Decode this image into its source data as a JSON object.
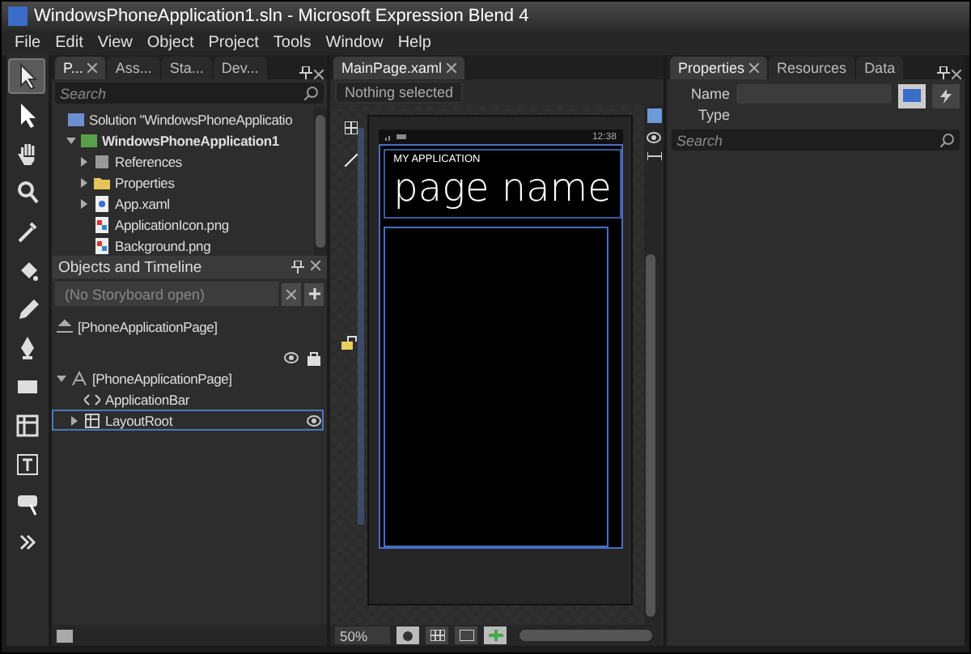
{
  "window": {
    "title": "WindowsPhoneApplication1.sln - Microsoft Expression Blend 4"
  },
  "menu": [
    "File",
    "Edit",
    "View",
    "Object",
    "Project",
    "Tools",
    "Window",
    "Help"
  ],
  "tools": [
    {
      "kind": "select",
      "selected": true
    },
    {
      "kind": "direct",
      "selected": false
    },
    {
      "kind": "hand",
      "selected": false
    },
    {
      "kind": "zoom",
      "selected": false
    },
    {
      "kind": "dropper",
      "selected": false
    },
    {
      "kind": "bucket",
      "selected": false
    },
    {
      "kind": "brush",
      "selected": false
    },
    {
      "kind": "pen",
      "selected": false
    },
    {
      "kind": "rect",
      "selected": false
    },
    {
      "kind": "grid",
      "selected": false
    },
    {
      "kind": "text",
      "selected": false
    },
    {
      "kind": "callout",
      "selected": false
    },
    {
      "kind": "more",
      "selected": false
    }
  ],
  "project_panel": {
    "tabs": [
      {
        "label": "P...",
        "selected": true
      },
      {
        "label": "Ass...",
        "selected": false
      },
      {
        "label": "Sta...",
        "selected": false
      },
      {
        "label": "Dev...",
        "selected": false
      }
    ],
    "search": {
      "placeholder": "Search"
    },
    "tree": [
      {
        "label": "Solution \"WindowsPhoneApplicatio",
        "kind": "solution",
        "children": [
          {
            "label": "WindowsPhoneApplication1",
            "kind": "project",
            "expanded": true,
            "children": [
              {
                "label": "References",
                "kind": "refs",
                "expanded": false
              },
              {
                "label": "Properties",
                "kind": "folder",
                "expanded": false
              },
              {
                "label": "App.xaml",
                "kind": "xaml",
                "expanded": false
              },
              {
                "label": "ApplicationIcon.png",
                "kind": "image"
              },
              {
                "label": "Background.png",
                "kind": "image"
              }
            ]
          }
        ]
      }
    ]
  },
  "objects_panel": {
    "title": "Objects and Timeline",
    "storyboard": "(No Storyboard open)",
    "root": "[PhoneApplicationPage]",
    "tree": [
      {
        "label": "[PhoneApplicationPage]",
        "kind": "page",
        "expanded": true,
        "selected": false,
        "children": [
          {
            "label": "ApplicationBar",
            "kind": "code",
            "selected": false
          },
          {
            "label": "LayoutRoot",
            "kind": "grid",
            "expanded": false,
            "selected": true
          }
        ]
      }
    ]
  },
  "document": {
    "tab": "MainPage.xaml",
    "breadcrumb": "Nothing selected",
    "zoom": "50%",
    "phone": {
      "time": "12:38",
      "app_title": "MY APPLICATION",
      "page_title": "page name"
    }
  },
  "properties_panel": {
    "tabs": [
      {
        "label": "Properties",
        "selected": true
      },
      {
        "label": "Resources",
        "selected": false
      },
      {
        "label": "Data",
        "selected": false
      }
    ],
    "name_label": "Name",
    "type_label": "Type",
    "search": {
      "placeholder": "Search"
    }
  }
}
